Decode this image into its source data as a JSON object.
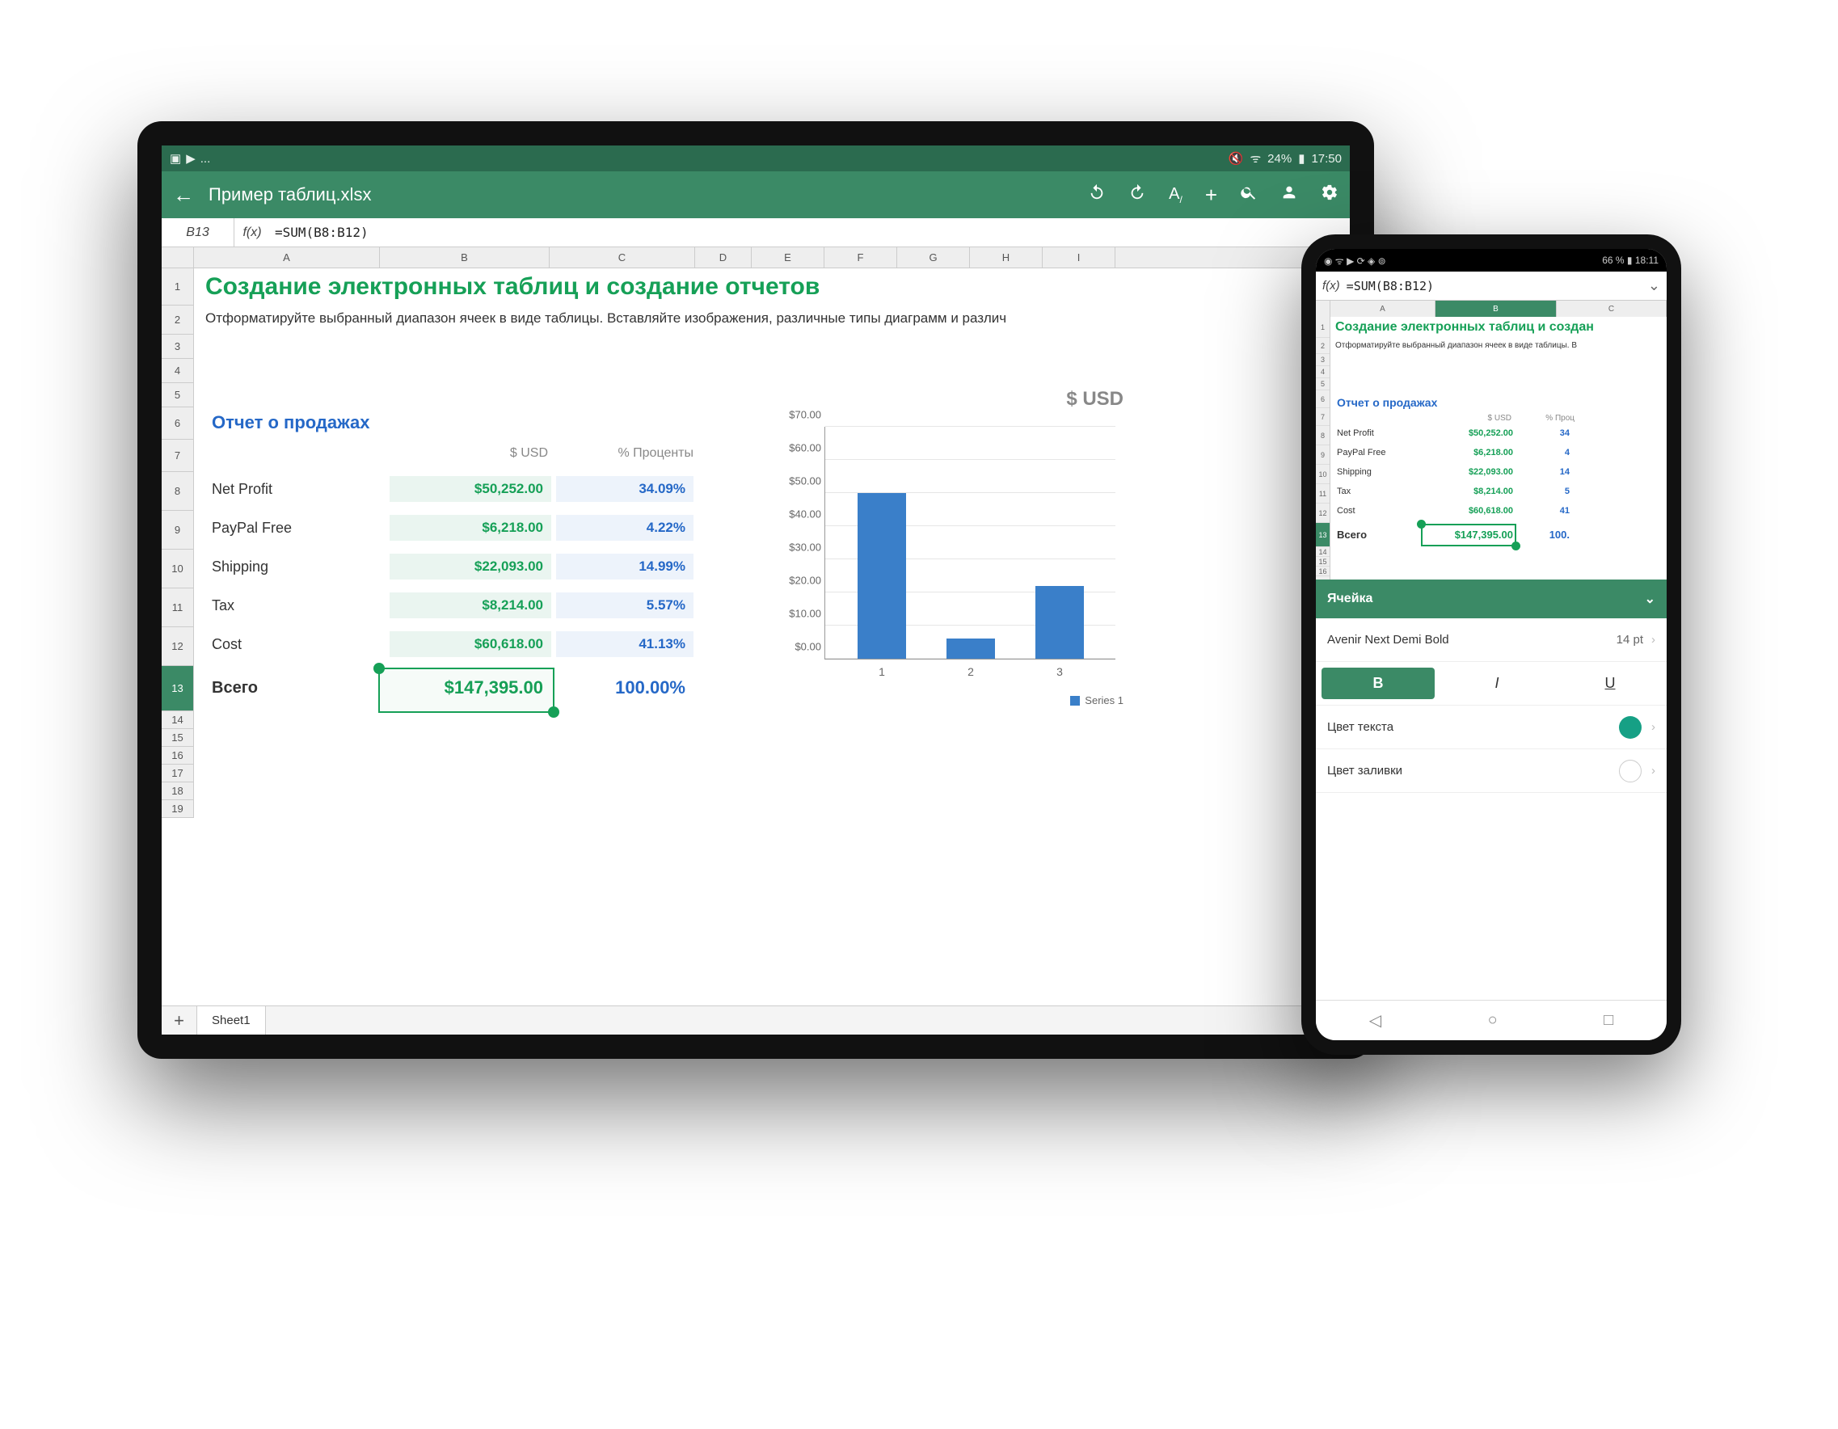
{
  "tablet": {
    "status": {
      "left_dots": "...",
      "battery_pct": "24%",
      "time": "17:50"
    },
    "app_title": "Пример таблиц.xlsx",
    "cell_ref": "B13",
    "fx_label": "f(x)",
    "formula": "=SUM(B8:B12)",
    "columns": [
      "A",
      "B",
      "C",
      "D",
      "E",
      "F",
      "G",
      "H",
      "I"
    ],
    "title": "Создание электронных таблиц и создание отчетов",
    "subtitle": "Отформатируйте выбранный диапазон ячеек в виде таблицы. Вставляйте изображения, различные типы диаграмм и различ",
    "report_title": "Отчет о продажах",
    "usd_header": "$ USD",
    "pct_header": "% Проценты",
    "rows": [
      {
        "label": "Net Profit",
        "usd": "$50,252.00",
        "pct": "34.09%"
      },
      {
        "label": "PayPal Free",
        "usd": "$6,218.00",
        "pct": "4.22%"
      },
      {
        "label": "Shipping",
        "usd": "$22,093.00",
        "pct": "14.99%"
      },
      {
        "label": "Tax",
        "usd": "$8,214.00",
        "pct": "5.57%"
      },
      {
        "label": "Cost",
        "usd": "$60,618.00",
        "pct": "41.13%"
      }
    ],
    "total": {
      "label": "Всего",
      "usd": "$147,395.00",
      "pct": "100.00%"
    },
    "sheet_tab": "Sheet1"
  },
  "chart_data": {
    "type": "bar",
    "title": "$ USD",
    "categories": [
      "1",
      "2",
      "3"
    ],
    "values": [
      50,
      6,
      22
    ],
    "ylim": [
      0,
      70
    ],
    "y_ticks": [
      "$0.00",
      "$10.00",
      "$20.00",
      "$30.00",
      "$40.00",
      "$50.00",
      "$60.00",
      "$70.00"
    ],
    "legend": "Series 1",
    "series_color": "#3a7fc9"
  },
  "phone": {
    "status": {
      "battery_pct": "66 %",
      "time": "18:11"
    },
    "fx_label": "f(x)",
    "formula": "=SUM(B8:B12)",
    "columns": [
      "A",
      "B",
      "C"
    ],
    "title": "Создание электронных таблиц и создан",
    "subtitle": "Отформатируйте выбранный диапазон ячеек в виде таблицы. В",
    "report_title": "Отчет о продажах",
    "usd_header": "$ USD",
    "pct_header": "% Проц",
    "rows": [
      {
        "label": "Net Profit",
        "usd": "$50,252.00",
        "pct": "34"
      },
      {
        "label": "PayPal Free",
        "usd": "$6,218.00",
        "pct": "4"
      },
      {
        "label": "Shipping",
        "usd": "$22,093.00",
        "pct": "14"
      },
      {
        "label": "Tax",
        "usd": "$8,214.00",
        "pct": "5"
      },
      {
        "label": "Cost",
        "usd": "$60,618.00",
        "pct": "41"
      }
    ],
    "total": {
      "label": "Всего",
      "usd": "$147,395.00",
      "pct": "100."
    },
    "panel": {
      "title": "Ячейка",
      "font_name": "Avenir Next Demi Bold",
      "font_size": "14 pt",
      "bold": "B",
      "italic": "I",
      "underline": "U",
      "text_color_label": "Цвет текста",
      "text_color": "#16a085",
      "fill_color_label": "Цвет заливки",
      "fill_color": "#ffffff"
    }
  }
}
